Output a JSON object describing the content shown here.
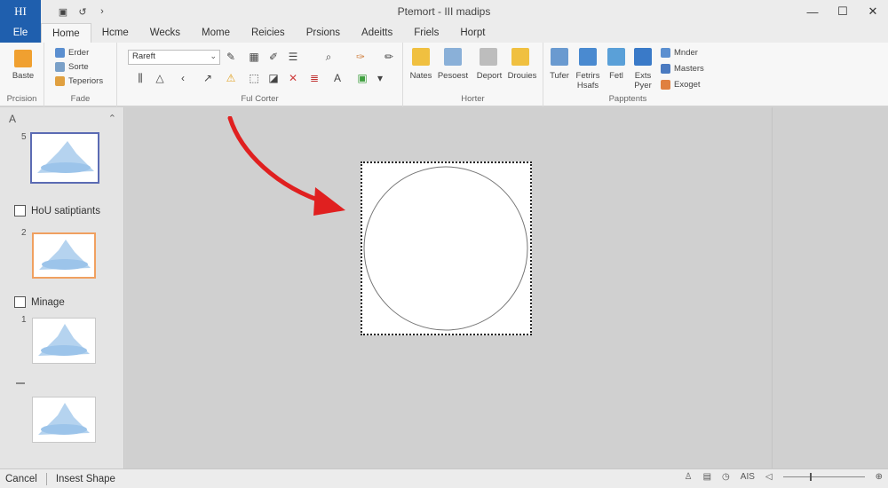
{
  "app": {
    "badge": "HI",
    "title": "Ptemort - III madips"
  },
  "quick_access": [
    "▣",
    "↺",
    "›"
  ],
  "window_controls": {
    "minimize": "—",
    "maximize": "☐",
    "close": "✕"
  },
  "tabs": [
    "Ele",
    "Home",
    "Hcme",
    "Wecks",
    "Mome",
    "Reicies",
    "Prsions",
    "Adeitts",
    "Friels",
    "Horpt"
  ],
  "active_tab": "Home",
  "ribbon": {
    "clipboard": {
      "paste_label": "Baste",
      "items": [
        "Erder",
        "Sorte",
        "Teperiors"
      ],
      "group_label": "Prcision"
    },
    "fade": {
      "group_label": "Fade"
    },
    "font": {
      "font_name": "Rareft",
      "group_label": "Ful Corter"
    },
    "arrange": {
      "labels": [
        "Nates",
        "Pesoest",
        "Deport",
        "Drouies"
      ],
      "group_label": "Horter"
    },
    "editing": {
      "labels": [
        "Tufer",
        "Fetrirs\nHsafs",
        "Fetl",
        "Exts\nPyer"
      ],
      "items": [
        "Mnder",
        "Masters",
        "Exoget"
      ],
      "group_label": "Papptents"
    }
  },
  "thumbnails": {
    "pane_title": "A",
    "sections": [
      "HoU satiptiants",
      "Minage"
    ],
    "slide_numbers": [
      "5",
      "2",
      "1"
    ]
  },
  "status": {
    "left": "Cancel",
    "mode": "Insest Shape",
    "zoom_label": "AIS"
  },
  "colors": {
    "file_tab": "#1f5fae",
    "arrow": "#e02020",
    "selected_thumb": "#5b6bb3",
    "section_thumb": "#f0a060"
  }
}
